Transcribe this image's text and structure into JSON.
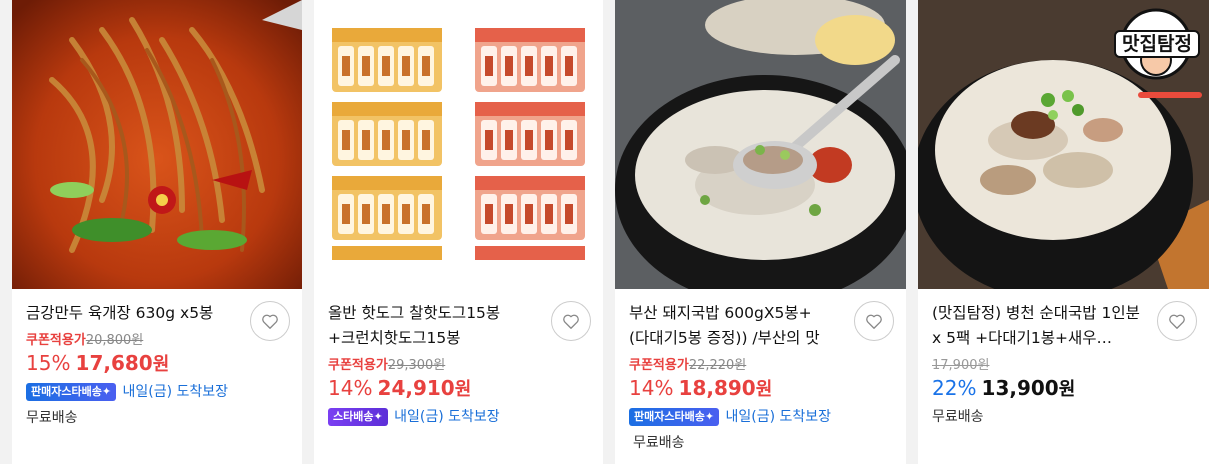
{
  "products": [
    {
      "title": "금강만두 육개장 630g x5봉",
      "coupon_label": "쿠폰적용가",
      "original_price": "20,800원",
      "discount": "15%",
      "price": "17,680",
      "won": "원",
      "badge": "판매자스타배송✦",
      "arrival": "내일(금) 도착보장",
      "shipping": "무료배송"
    },
    {
      "title": "올반 핫도그 찰핫도그15봉 +크런치핫도그15봉",
      "coupon_label": "쿠폰적용가",
      "original_price": "29,300원",
      "discount": "14%",
      "price": "24,910",
      "won": "원",
      "badge": "스타배송✦",
      "arrival": "내일(금) 도착보장"
    },
    {
      "title": "부산 돼지국밥 600gX5봉+(다대기5봉 증정)) /부산의 맛",
      "coupon_label": "쿠폰적용가",
      "original_price": "22,220원",
      "discount": "14%",
      "price": "18,890",
      "won": "원",
      "badge": "판매자스타배송✦",
      "arrival": "내일(금) 도착보장",
      "shipping": "무료배송"
    },
    {
      "title": "(맛집탐정) 병천 순대국밥 1인분 x 5팩 +다대기1봉+새우…",
      "original_price": "17,900원",
      "discount": "22%",
      "price": "13,900",
      "won": "원",
      "shipping": "무료배송",
      "logo_text": "맛집탐정"
    }
  ],
  "colors": {
    "discount_red": "#e8413f",
    "arrival_blue": "#1a6fd8",
    "seller_badge": "#1b6fe3",
    "star_badge": "#7a3ff2"
  },
  "icons": {
    "wishlist": "heart-outline-icon"
  }
}
